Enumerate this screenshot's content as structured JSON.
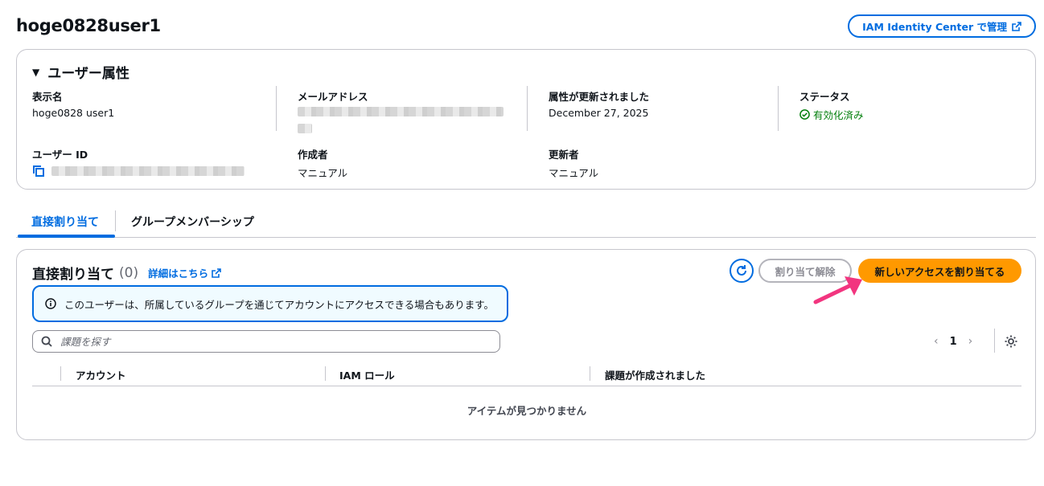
{
  "page": {
    "title": "hoge0828user1",
    "manage_button": "IAM Identity Center で管理"
  },
  "attributes": {
    "header": "ユーザー属性",
    "display_name_label": "表示名",
    "display_name": "hoge0828 user1",
    "email_label": "メールアドレス",
    "updated_label": "属性が更新されました",
    "updated_value": "December 27, 2025",
    "status_label": "ステータス",
    "status_value": "有効化済み",
    "user_id_label": "ユーザー ID",
    "created_by_label": "作成者",
    "created_by": "マニュアル",
    "updated_by_label": "更新者",
    "updated_by": "マニュアル"
  },
  "tabs": [
    {
      "label": "直接割り当て",
      "active": true
    },
    {
      "label": "グループメンバーシップ",
      "active": false
    }
  ],
  "assignments": {
    "title": "直接割り当て",
    "count": "(0)",
    "info_link": "詳細はこちら",
    "unassign_button": "割り当て解除",
    "assign_button": "新しいアクセスを割り当てる",
    "alert": "このユーザーは、所属しているグループを通じてアカウントにアクセスできる場合もあります。",
    "search_placeholder": "課題を探す",
    "page_number": "1",
    "columns": [
      "アカウント",
      "IAM ロール",
      "課題が作成されました"
    ],
    "empty_text": "アイテムが見つかりません"
  },
  "colors": {
    "primary": "#006ce0",
    "accent": "#ff9900",
    "success": "#037f0c",
    "annotation_arrow": "#f2357f"
  }
}
